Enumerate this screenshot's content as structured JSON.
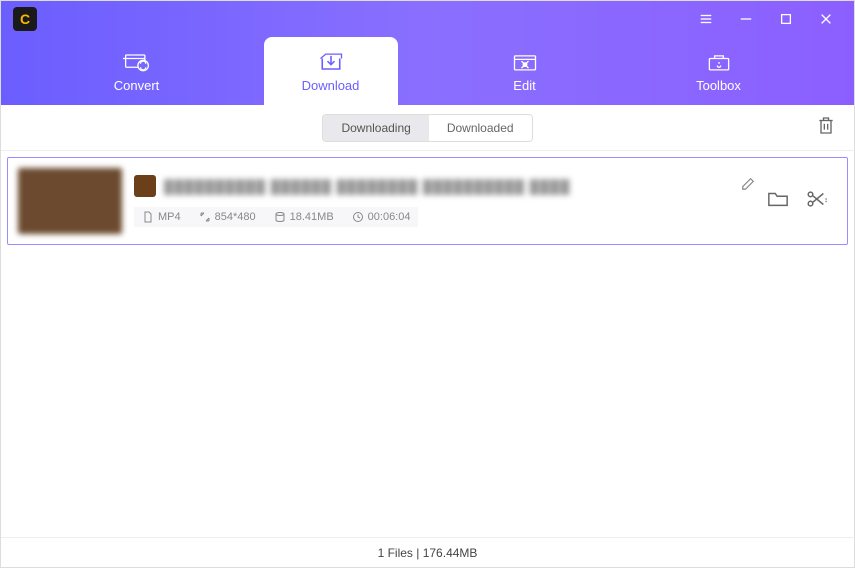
{
  "app": {
    "logo_letter": "C"
  },
  "nav": {
    "tabs": [
      {
        "label": "Convert"
      },
      {
        "label": "Download"
      },
      {
        "label": "Edit"
      },
      {
        "label": "Toolbox"
      }
    ]
  },
  "subTabs": {
    "downloading": "Downloading",
    "downloaded": "Downloaded"
  },
  "file": {
    "title": "██████████ ██████ ████████ ██████████ ████",
    "format": "MP4",
    "resolution": "854*480",
    "size": "18.41MB",
    "duration": "00:06:04"
  },
  "footer": {
    "status": "1  Files | 176.44MB"
  }
}
